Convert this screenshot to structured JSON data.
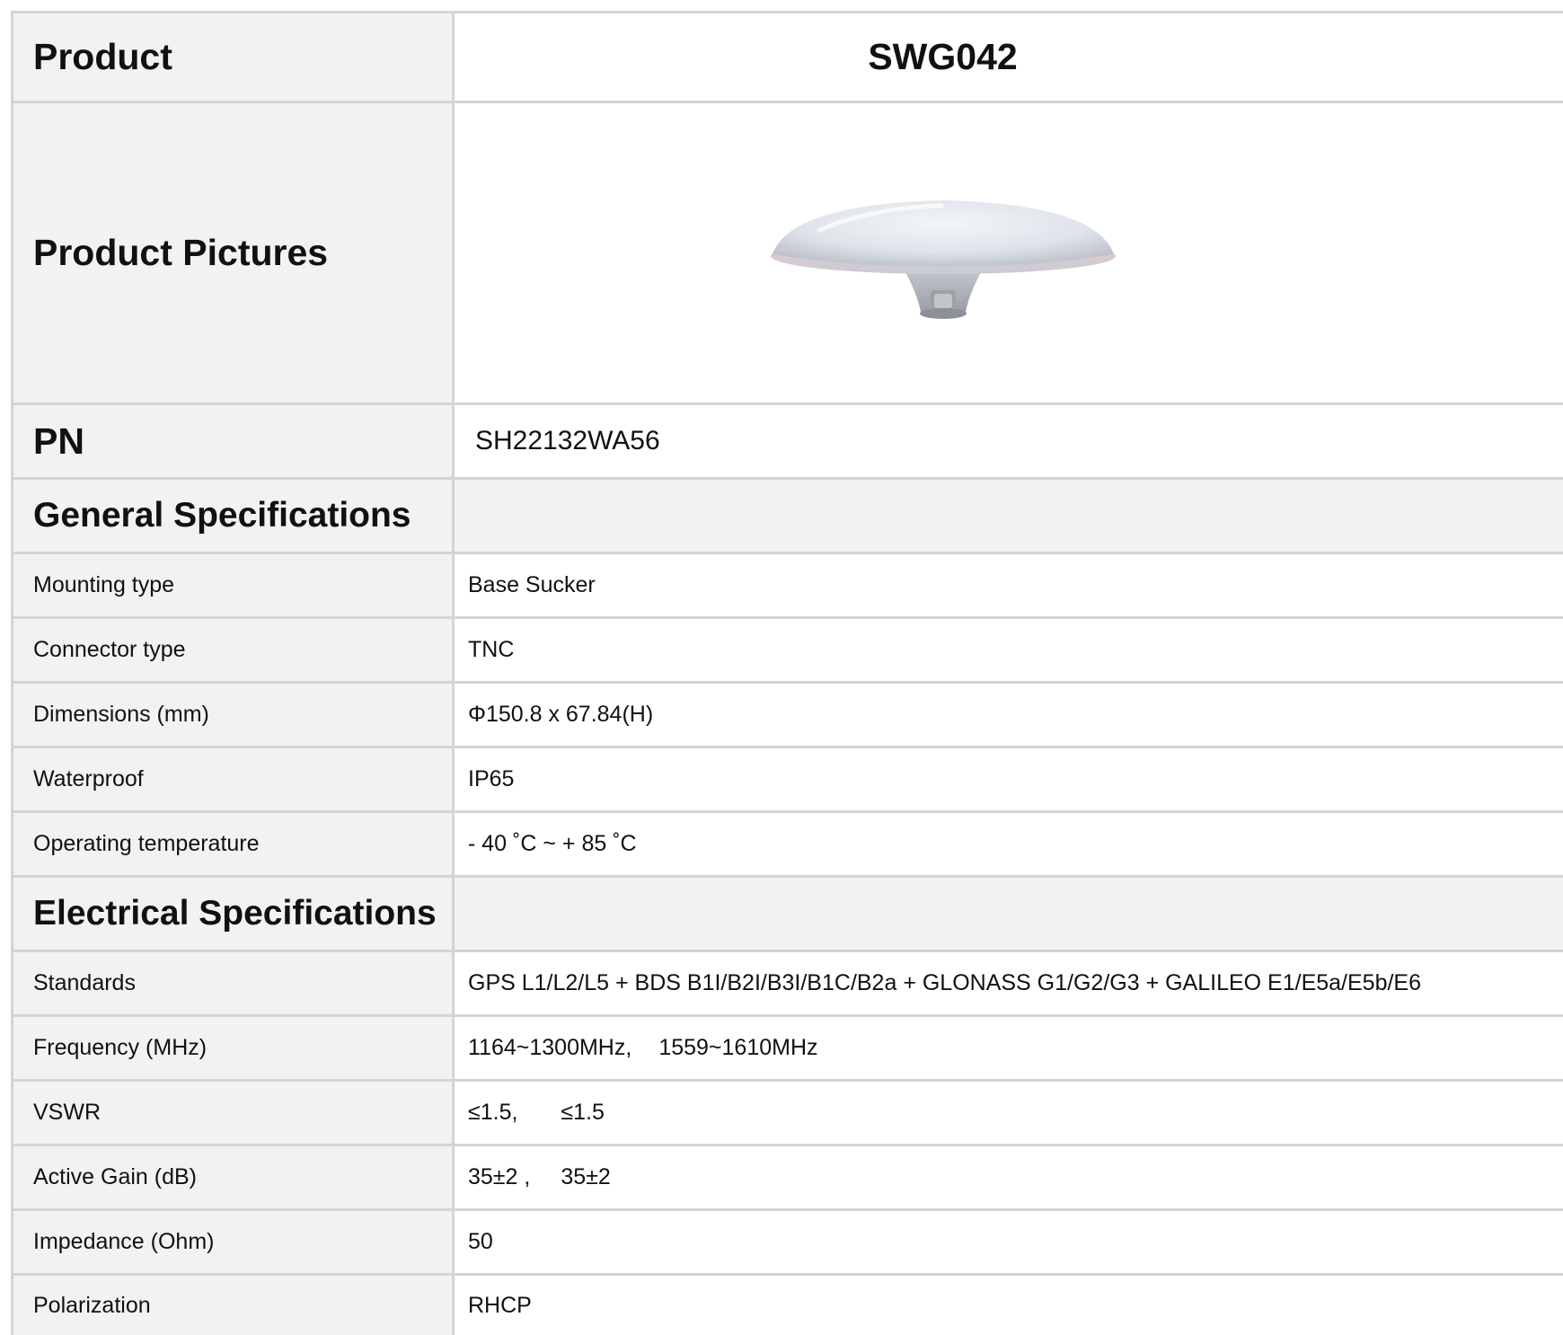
{
  "header": {
    "product_label": "Product",
    "product_value": "SWG042"
  },
  "picture": {
    "label": "Product Pictures",
    "image_icon": "gnss-antenna-icon"
  },
  "pn": {
    "label": "PN",
    "value": "SH22132WA56"
  },
  "general": {
    "title": "General Specifications",
    "rows": [
      {
        "label": "Mounting type",
        "value": "Base Sucker"
      },
      {
        "label": "Connector type",
        "value": "TNC"
      },
      {
        "label": "Dimensions (mm)",
        "value": "Φ150.8 x 67.84(H)"
      },
      {
        "label": "Waterproof",
        "value": "IP65"
      },
      {
        "label": "Operating temperature",
        "value": "- 40 ˚C ~ + 85 ˚C"
      }
    ]
  },
  "electrical": {
    "title": "Electrical Specifications",
    "rows": [
      {
        "label": "Standards",
        "value": "GPS L1/L2/L5 + BDS B1I/B2I/B3I/B1C/B2a + GLONASS G1/G2/G3 + GALILEO E1/E5a/E5b/E6"
      },
      {
        "label": "Frequency (MHz)",
        "value_a": "1164~1300MHz,",
        "value_b": "1559~1610MHz"
      },
      {
        "label": "VSWR",
        "value_a": "≤1.5,",
        "value_b": "≤1.5"
      },
      {
        "label": "Active Gain (dB)",
        "value_a": "35±2 ,",
        "value_b": "35±2"
      },
      {
        "label": "Impedance (Ohm)",
        "value": "50"
      },
      {
        "label": "Polarization",
        "value": "RHCP"
      }
    ]
  },
  "colors": {
    "border": "#d4d4d4",
    "label_background": "#f2f2f2",
    "text": "#111111"
  }
}
